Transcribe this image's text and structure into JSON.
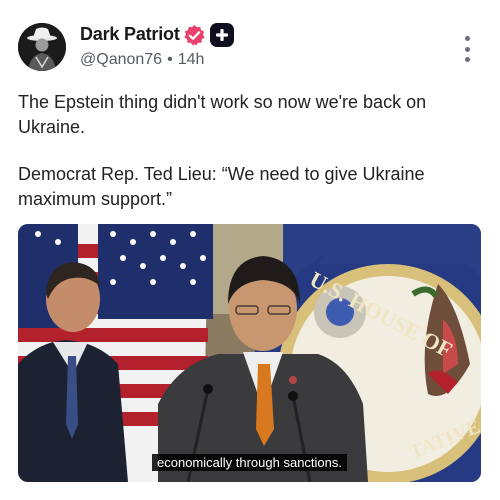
{
  "author": {
    "display_name": "Dark Patriot",
    "handle": "@Qanon76",
    "separator": "•",
    "time_ago": "14h",
    "avatar_icon": "avatar-icon",
    "verified_icon": "verified-badge-icon",
    "plus_icon": "plus-badge-icon"
  },
  "post": {
    "paragraph1": "The Epstein thing didn't work so now we're back on Ukraine.",
    "paragraph2": "Democrat Rep. Ted Lieu: “We need to give Ukraine maximum support.”"
  },
  "video": {
    "caption": "economically through sanctions.",
    "seal_text": "U.S. HOUSE OF",
    "seal_text_right": "TATIVE"
  },
  "colors": {
    "verified_pink": "#e8416e",
    "plus_dark": "#0e1020",
    "tie_orange": "#d9791f",
    "seal_blue": "#253a82"
  }
}
